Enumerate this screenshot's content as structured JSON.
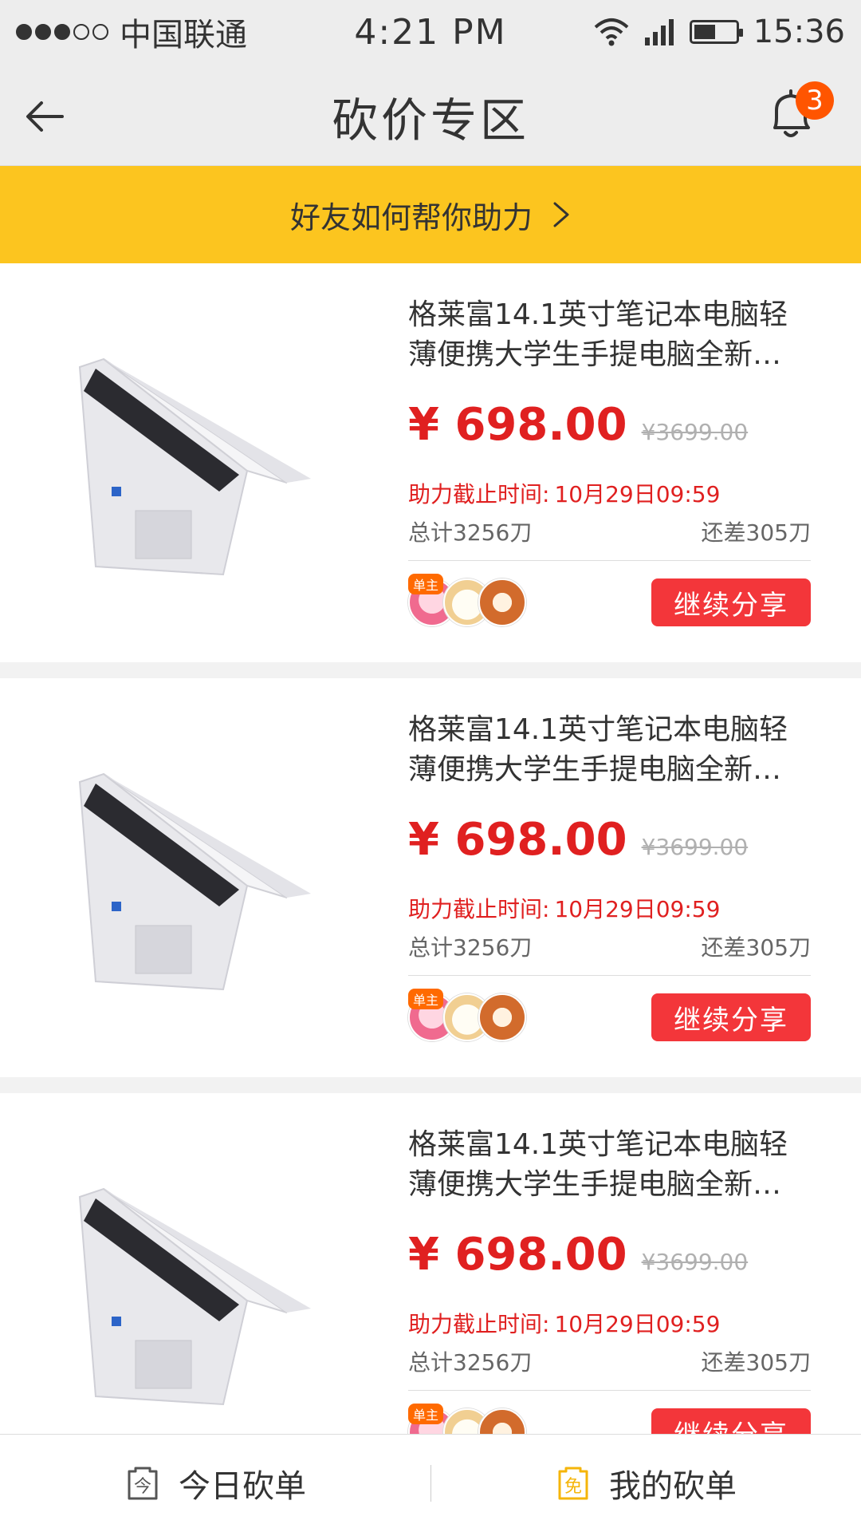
{
  "status_bar": {
    "carrier": "中国联通",
    "time": "4:21 PM",
    "clock": "15:36"
  },
  "header": {
    "title": "砍价专区",
    "badge_count": "3"
  },
  "banner": {
    "text": "好友如何帮你助力"
  },
  "products": [
    {
      "title": "格莱富14.1英寸笔记本电脑轻薄便携大学生手提电脑全新…",
      "price": "¥ 698.00",
      "original_price": "¥3699.00",
      "deadline_label": "助力截止时间:",
      "deadline_value": "10月29日09:59",
      "total_cut": "总计3256刀",
      "remaining": "还差305刀",
      "owner_tag": "单主",
      "share_label": "继续分享"
    },
    {
      "title": "格莱富14.1英寸笔记本电脑轻薄便携大学生手提电脑全新…",
      "price": "¥ 698.00",
      "original_price": "¥3699.00",
      "deadline_label": "助力截止时间:",
      "deadline_value": "10月29日09:59",
      "total_cut": "总计3256刀",
      "remaining": "还差305刀",
      "owner_tag": "单主",
      "share_label": "继续分享"
    },
    {
      "title": "格莱富14.1英寸笔记本电脑轻薄便携大学生手提电脑全新…",
      "price": "¥ 698.00",
      "original_price": "¥3699.00",
      "deadline_label": "助力截止时间:",
      "deadline_value": "10月29日09:59",
      "total_cut": "总计3256刀",
      "remaining": "还差305刀",
      "owner_tag": "单主",
      "share_label": "继续分享"
    }
  ],
  "tabs": [
    {
      "label": "今日砍单",
      "icon": "today-orders-icon",
      "icon_char": "今"
    },
    {
      "label": "我的砍单",
      "icon": "my-orders-icon",
      "icon_char": "免"
    }
  ],
  "colors": {
    "accent_yellow": "#fcc51f",
    "price_red": "#e02020",
    "button_red": "#f3363a",
    "badge_orange": "#ff5500"
  },
  "battery_level": 0.6
}
